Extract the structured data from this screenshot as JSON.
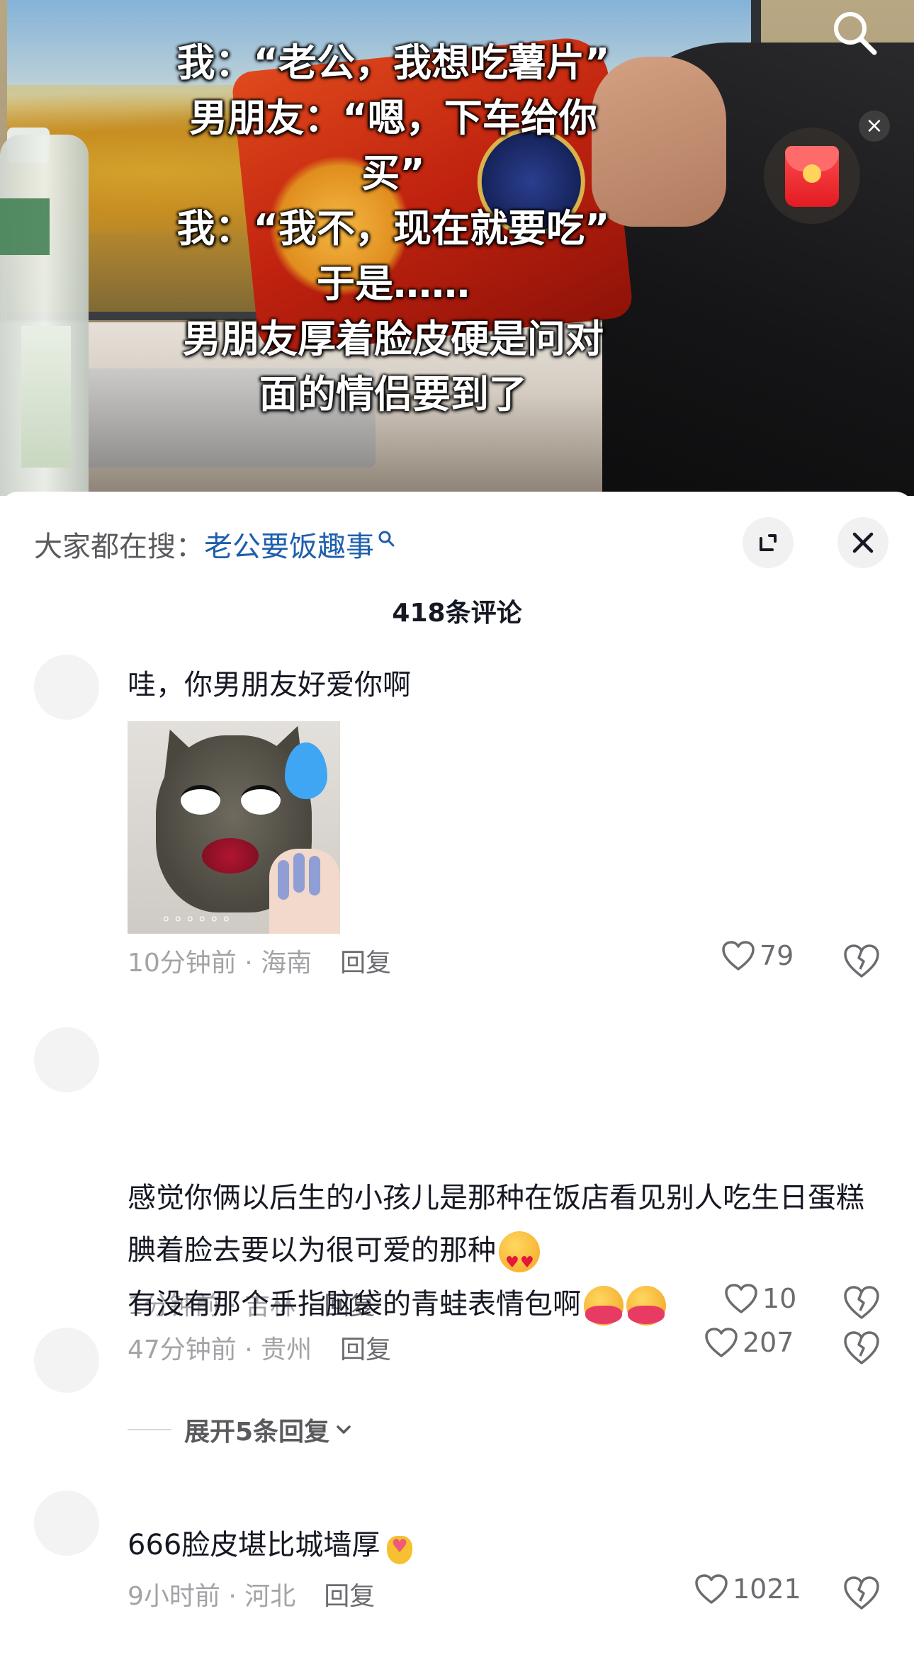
{
  "video": {
    "caption_lines": [
      "我：“老公，我想吃薯片”",
      "男朋友：“嗯，下车给你",
      "买”",
      "我：“我不，现在就要吃”",
      "于是……",
      "男朋友厚着脸皮硬是问对",
      "面的情侣要到了"
    ],
    "close_glyph": "×"
  },
  "sheet": {
    "search_prefix": "大家都在搜：",
    "search_term": "老公要饭趣事",
    "comment_count": "418条评论",
    "comments": [
      {
        "text": "哇，你男朋友好爱你啊",
        "sticker_caption": "。。。。。。",
        "time": "10分钟前 · 海南",
        "reply": "回复",
        "likes": "79"
      },
      {
        "text": "感觉你俩以后生的小孩儿是那种在饭店看见别人吃生日蛋糕腆着脸去要以为很可爱的那种",
        "emoji": "smiling-face-with-hearts-icon",
        "time": "1分钟前 · 吉林",
        "reply": "回复",
        "likes": "10"
      },
      {
        "text": "有没有那个手指脑袋的青蛙表情包啊",
        "emoji": "hugging-face-icon",
        "time": "47分钟前 · 贵州",
        "reply": "回复",
        "likes": "207",
        "expand_label": "展开5条回复"
      },
      {
        "text": "666脸皮堪比城墙厚",
        "emoji": "finger-heart-icon",
        "time": "9小时前 · 河北",
        "reply": "回复",
        "likes": "1021"
      }
    ]
  },
  "colors": {
    "search_term": "#1e5fad",
    "meta_text": "#a3a3a7",
    "primary_text": "#161823",
    "red_packet": "#e21b22"
  }
}
